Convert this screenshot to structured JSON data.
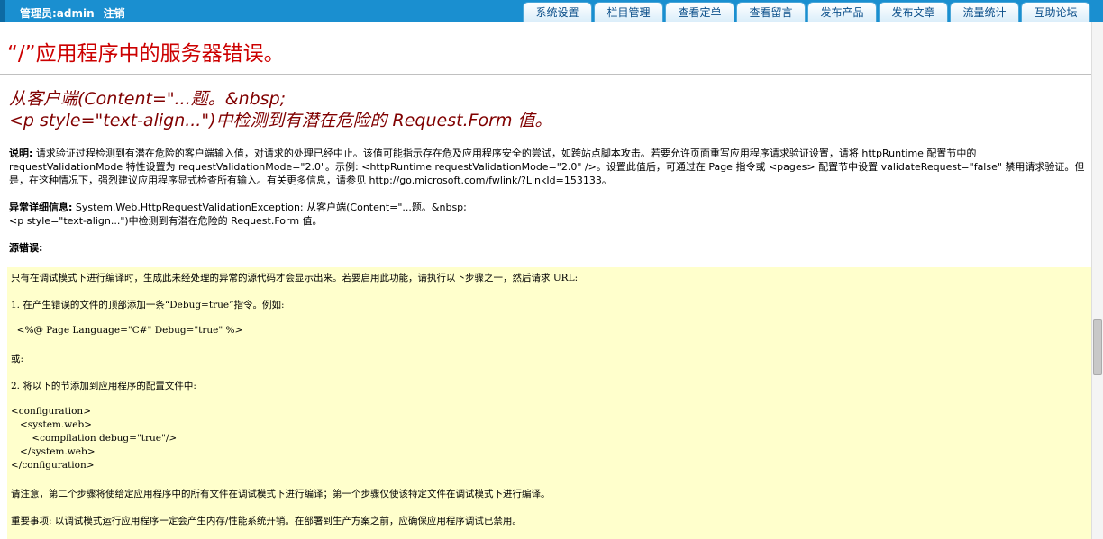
{
  "header": {
    "admin_label": "管理员:admin",
    "logout_label": "注销",
    "tabs": [
      "系统设置",
      "栏目管理",
      "查看定单",
      "查看留言",
      "发布产品",
      "发布文章",
      "流量统计",
      "互助论坛"
    ]
  },
  "error": {
    "title": "“/”应用程序中的服务器错误。",
    "subtitle_line1": "从客户端(Content=\"...题。&nbsp;",
    "subtitle_line2": "<p style=\"text-align...\")中检测到有潜在危险的 Request.Form 值。",
    "desc_label": "说明:",
    "desc_text": "请求验证过程检测到有潜在危险的客户端输入值，对请求的处理已经中止。该值可能指示存在危及应用程序安全的尝试，如跨站点脚本攻击。若要允许页面重写应用程序请求验证设置，请将 httpRuntime 配置节中的 requestValidationMode 特性设置为 requestValidationMode=\"2.0\"。示例: <httpRuntime requestValidationMode=\"2.0\" />。设置此值后，可通过在 Page 指令或 <pages> 配置节中设置 validateRequest=\"false\" 禁用请求验证。但是，在这种情况下，强烈建议应用程序显式检查所有输入。有关更多信息，请参见 http://go.microsoft.com/fwlink/?LinkId=153133。",
    "exception_label": "异常详细信息:",
    "exception_text": "System.Web.HttpRequestValidationException: 从客户端(Content=\"...题。&nbsp;",
    "exception_text2": "<p style=\"text-align...\")中检测到有潜在危险的 Request.Form 值。",
    "source_label": "源错误:"
  },
  "source_box": {
    "lines": [
      "只有在调试模式下进行编译时，生成此未经处理的异常的源代码才会显示出来。若要启用此功能，请执行以下步骤之一，然后请求 URL:",
      "1. 在产生错误的文件的顶部添加一条“Debug=true”指令。例如:",
      "  <%@ Page Language=\"C#\" Debug=\"true\" %>",
      "或:",
      "2. 将以下的节添加到应用程序的配置文件中:",
      "<configuration>",
      "   <system.web>",
      "       <compilation debug=\"true\"/>",
      "   </system.web>",
      "</configuration>",
      "请注意，第二个步骤将使给定应用程序中的所有文件在调试模式下进行编译；第一个步骤仅使该特定文件在调试模式下进行编译。",
      "重要事项: 以调试模式运行应用程序一定会产生内存/性能系统开销。在部署到生产方案之前，应确保应用程序调试已禁用。"
    ]
  }
}
